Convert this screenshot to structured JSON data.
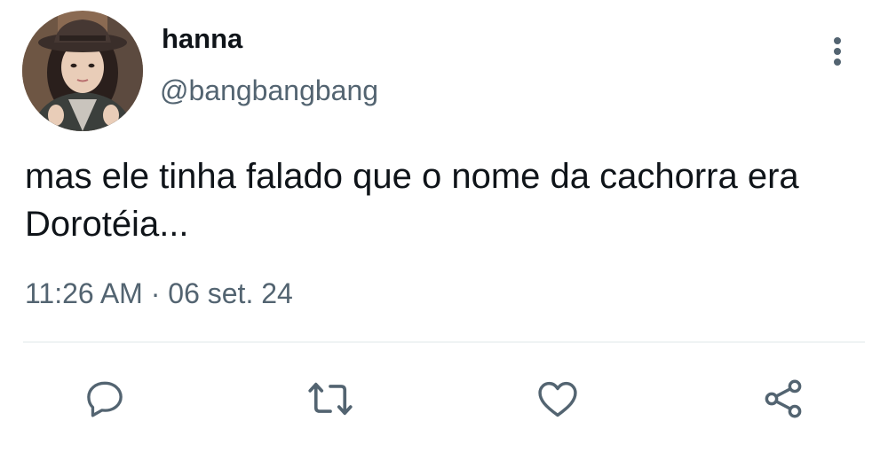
{
  "author": {
    "display_name": "hanna",
    "handle": "@bangbangbang"
  },
  "tweet": {
    "text": "mas ele tinha falado que o nome da cachorra era Dorotéia...",
    "time": "11:26 AM",
    "separator": "·",
    "date": "06 set. 24"
  },
  "actions": [
    {
      "icon": "reply-icon"
    },
    {
      "icon": "retweet-icon"
    },
    {
      "icon": "like-icon"
    },
    {
      "icon": "share-icon"
    }
  ],
  "colors": {
    "text_primary": "#0f1419",
    "text_secondary": "#536471",
    "divider": "#eff3f4",
    "icon": "#536471"
  }
}
